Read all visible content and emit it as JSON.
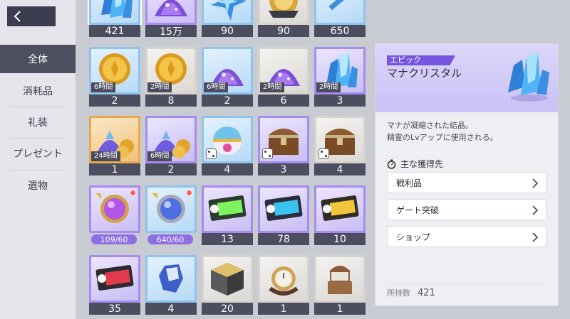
{
  "nav": {
    "back_icon": "chevron-left-icon",
    "categories": [
      {
        "label": "全体",
        "active": true
      },
      {
        "label": "消耗品",
        "active": false
      },
      {
        "label": "礼装",
        "active": false
      },
      {
        "label": "プレゼント",
        "active": false
      },
      {
        "label": "遺物",
        "active": false
      }
    ]
  },
  "grid": {
    "rows": [
      [
        {
          "icon": "blue-crystal-icon",
          "frame": "blue",
          "qty": "421",
          "selected": true
        },
        {
          "icon": "purple-gem-pile-icon",
          "frame": "purple",
          "qty": "15万"
        },
        {
          "icon": "blue-star-shard-icon",
          "frame": "blue",
          "qty": "90"
        },
        {
          "icon": "gold-emblem-icon",
          "frame": "gray",
          "qty": "90"
        },
        {
          "icon": "blue-key-icon",
          "frame": "blue",
          "qty": "650"
        }
      ],
      [
        {
          "icon": "gold-coin-icon",
          "frame": "blue",
          "qty": "2",
          "time": "6時間"
        },
        {
          "icon": "gold-coin-icon",
          "frame": "gray",
          "qty": "8",
          "time": "2時間"
        },
        {
          "icon": "purple-gem-pile-icon",
          "frame": "blue",
          "qty": "2",
          "time": "6時間"
        },
        {
          "icon": "purple-gem-pile-icon",
          "frame": "gray",
          "qty": "6",
          "time": "2時間"
        },
        {
          "icon": "blue-crystal-icon",
          "frame": "purple",
          "qty": "3",
          "time": "2時間"
        }
      ],
      [
        {
          "icon": "gem-coin-pile-icon",
          "frame": "gold",
          "qty": "1",
          "time": "24時間"
        },
        {
          "icon": "gem-coin-pile-icon",
          "frame": "purple",
          "qty": "2",
          "time": "6時間"
        },
        {
          "icon": "gift-capsule-icon",
          "frame": "blue",
          "qty": "4",
          "dice": true
        },
        {
          "icon": "treasure-chest-icon",
          "frame": "purple",
          "qty": "3",
          "dice": true
        },
        {
          "icon": "treasure-chest-icon",
          "frame": "gray",
          "qty": "4",
          "dice": true
        }
      ],
      [
        {
          "icon": "purple-orb-emblem-icon",
          "frame": "purple",
          "pill": "109/60",
          "dot": true
        },
        {
          "icon": "silver-orb-emblem-icon",
          "frame": "blue",
          "pill": "640/60",
          "dot": true
        },
        {
          "icon": "green-ticket-icon",
          "frame": "purple",
          "qty": "13"
        },
        {
          "icon": "blue-ticket-icon",
          "frame": "purple",
          "qty": "78"
        },
        {
          "icon": "gold-ticket-icon",
          "frame": "purple",
          "qty": "10"
        }
      ],
      [
        {
          "icon": "red-ticket-icon",
          "frame": "purple",
          "qty": "35"
        },
        {
          "icon": "blue-gem-icon",
          "frame": "blue",
          "qty": "4"
        },
        {
          "icon": "gold-cube-icon",
          "frame": "gray",
          "qty": "20"
        },
        {
          "icon": "pocket-watch-icon",
          "frame": "gray",
          "qty": "1"
        },
        {
          "icon": "music-box-icon",
          "frame": "gray",
          "qty": "1"
        }
      ]
    ]
  },
  "detail": {
    "rarity": "エピック",
    "name": "マナクリスタル",
    "icon": "blue-crystal-icon",
    "description": [
      "マナが凝縮された結晶。",
      "精霊のLvアップに使用される。"
    ],
    "sources_title": "主な獲得先",
    "sources_icon": "compass-icon",
    "sources": [
      "戦利品",
      "ゲート突破",
      "ショップ"
    ],
    "held_label": "所持数",
    "held_value": "421"
  },
  "colors": {
    "accent_purple": "#7656e0",
    "nav_active": "#4e5062",
    "qty_bar": "#4c4d5e"
  }
}
